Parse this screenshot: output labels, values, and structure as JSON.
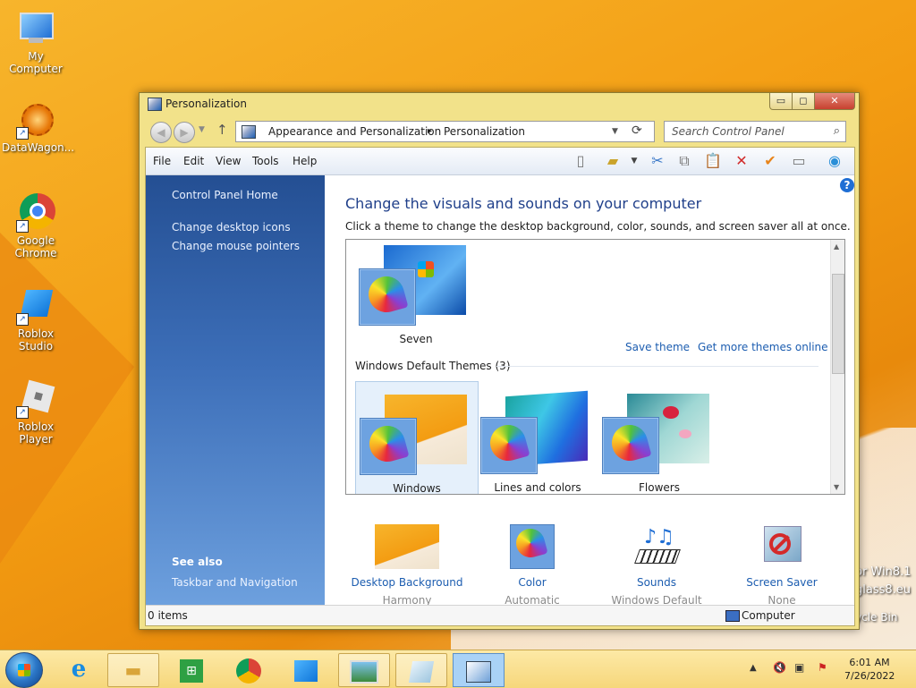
{
  "desktop": {
    "icons": [
      {
        "label": "My Computer",
        "icon": "my-computer-icon"
      },
      {
        "label": "DataWagon...",
        "icon": "datawagon-icon"
      },
      {
        "label": "Google\nChrome",
        "line1": "Google",
        "line2": "Chrome",
        "icon": "chrome-icon"
      },
      {
        "label": "Roblox Studio",
        "icon": "roblox-studio-icon"
      },
      {
        "label": "Roblox Player",
        "icon": "roblox-player-icon"
      }
    ],
    "overlay_line1": "or Win8.1",
    "overlay_line2": "glass8.eu",
    "recycle_bin": "ycle Bin"
  },
  "window": {
    "title": "Personalization",
    "close_symbol": "✕",
    "min_symbol": "▭",
    "max_symbol": "◻",
    "address": {
      "segments": [
        "Appearance and Personalization",
        "Personalization"
      ],
      "separator": "▸"
    },
    "search_placeholder": "Search Control Panel",
    "menu": [
      "File",
      "Edit",
      "View",
      "Tools",
      "Help"
    ],
    "left_pane": {
      "home": "Control Panel Home",
      "links": [
        "Change desktop icons",
        "Change mouse pointers"
      ],
      "see_also_title": "See also",
      "see_also_links": [
        "Taskbar and Navigation"
      ]
    },
    "main": {
      "heading": "Change the visuals and sounds on your computer",
      "subtext": "Click a theme to change the desktop background, color, sounds, and screen saver all at once.",
      "my_theme": "Seven",
      "save_theme": "Save theme",
      "get_more": "Get more themes online",
      "group_title": "Windows Default Themes (3)",
      "default_themes": [
        "Windows",
        "Lines and colors",
        "Flowers"
      ],
      "bottom": [
        {
          "label": "Desktop Background",
          "sub": "Harmony"
        },
        {
          "label": "Color",
          "sub": "Automatic"
        },
        {
          "label": "Sounds",
          "sub": "Windows Default"
        },
        {
          "label": "Screen Saver",
          "sub": "None"
        }
      ]
    },
    "status": {
      "items": "0 items",
      "location": "Computer"
    }
  },
  "taskbar": {
    "time": "6:01 AM",
    "date": "7/26/2022"
  },
  "colors": {
    "accent": "#1c5db0",
    "window_frame": "#f2e28a",
    "desktop": "#f39c12"
  }
}
